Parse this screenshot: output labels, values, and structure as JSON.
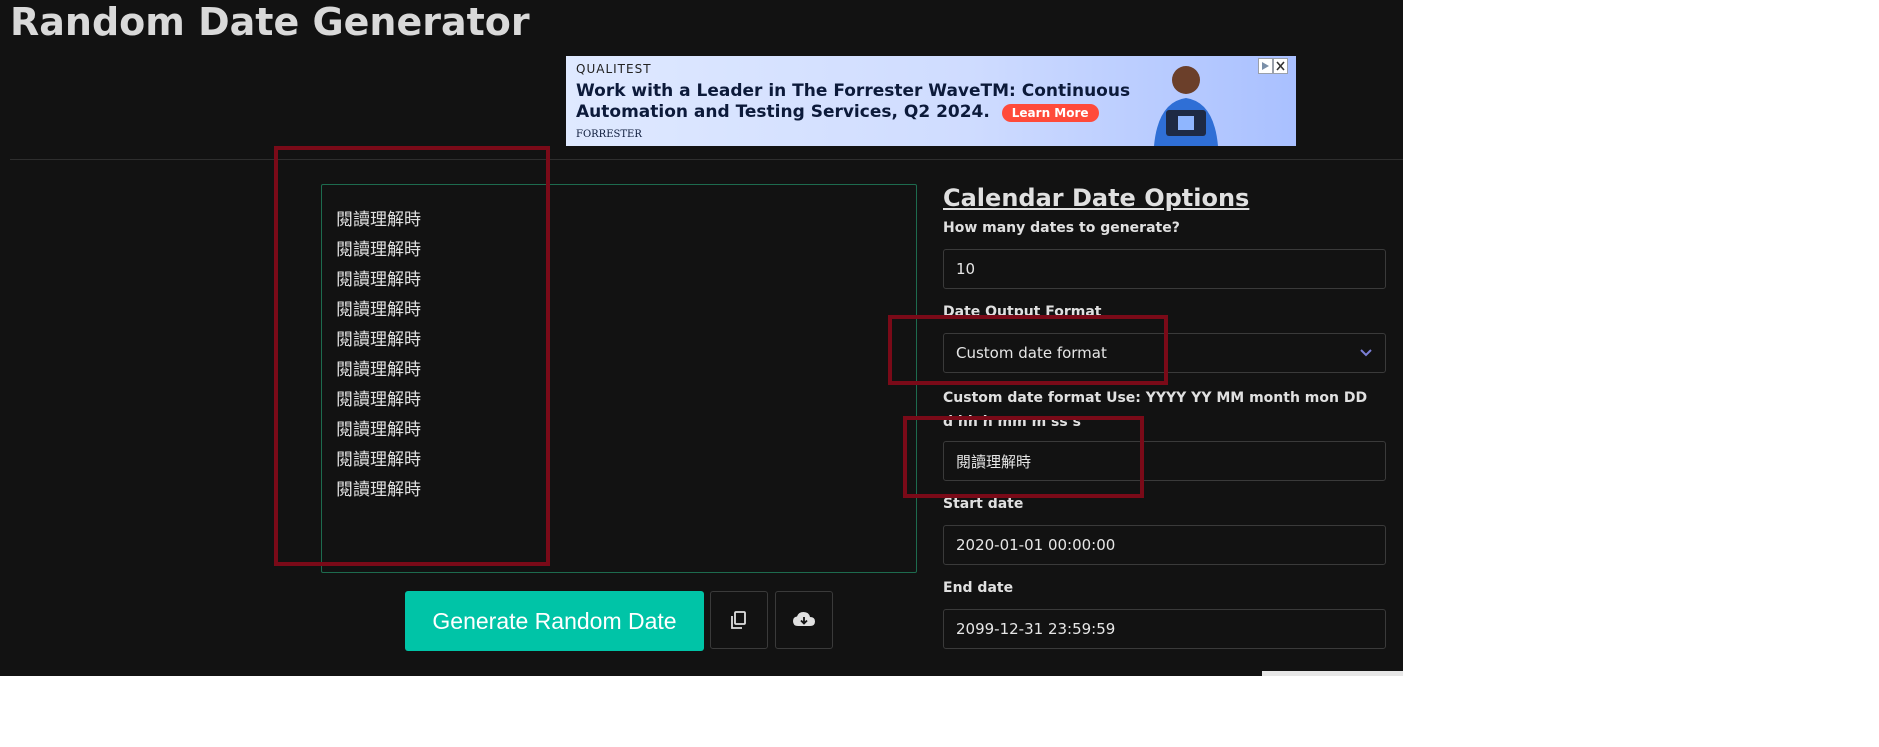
{
  "page": {
    "title": "Random Date Generator"
  },
  "ad": {
    "brand": "QUALITEST",
    "headline": "Work with a Leader in The Forrester WaveTM: Continuous Automation and Testing Services, Q2 2024.",
    "cta": "Learn More",
    "footer": "FORRESTER"
  },
  "output": {
    "lines": [
      "閱讀理解時",
      "閱讀理解時",
      "閱讀理解時",
      "閱讀理解時",
      "閱讀理解時",
      "閱讀理解時",
      "閱讀理解時",
      "閱讀理解時",
      "閱讀理解時",
      "閱讀理解時"
    ]
  },
  "actions": {
    "generate_label": "Generate Random Date",
    "copy_icon": "copy-icon",
    "download_icon": "cloud-download-icon"
  },
  "options": {
    "heading": "Calendar Date Options",
    "count_label": "How many dates to generate?",
    "count_value": "10",
    "format_label": "Date Output Format",
    "format_value": "Custom date format",
    "custom_label": "Custom date format Use: YYYY YY MM month mon DD d hh h mm m ss s",
    "custom_value": "閱讀理解時",
    "start_label": "Start date",
    "start_value": "2020-01-01 00:00:00",
    "end_label": "End date",
    "end_value": "2099-12-31 23:59:59"
  },
  "colors": {
    "background": "#121212",
    "accent": "#00c4a7",
    "highlight": "#7a0a18"
  }
}
